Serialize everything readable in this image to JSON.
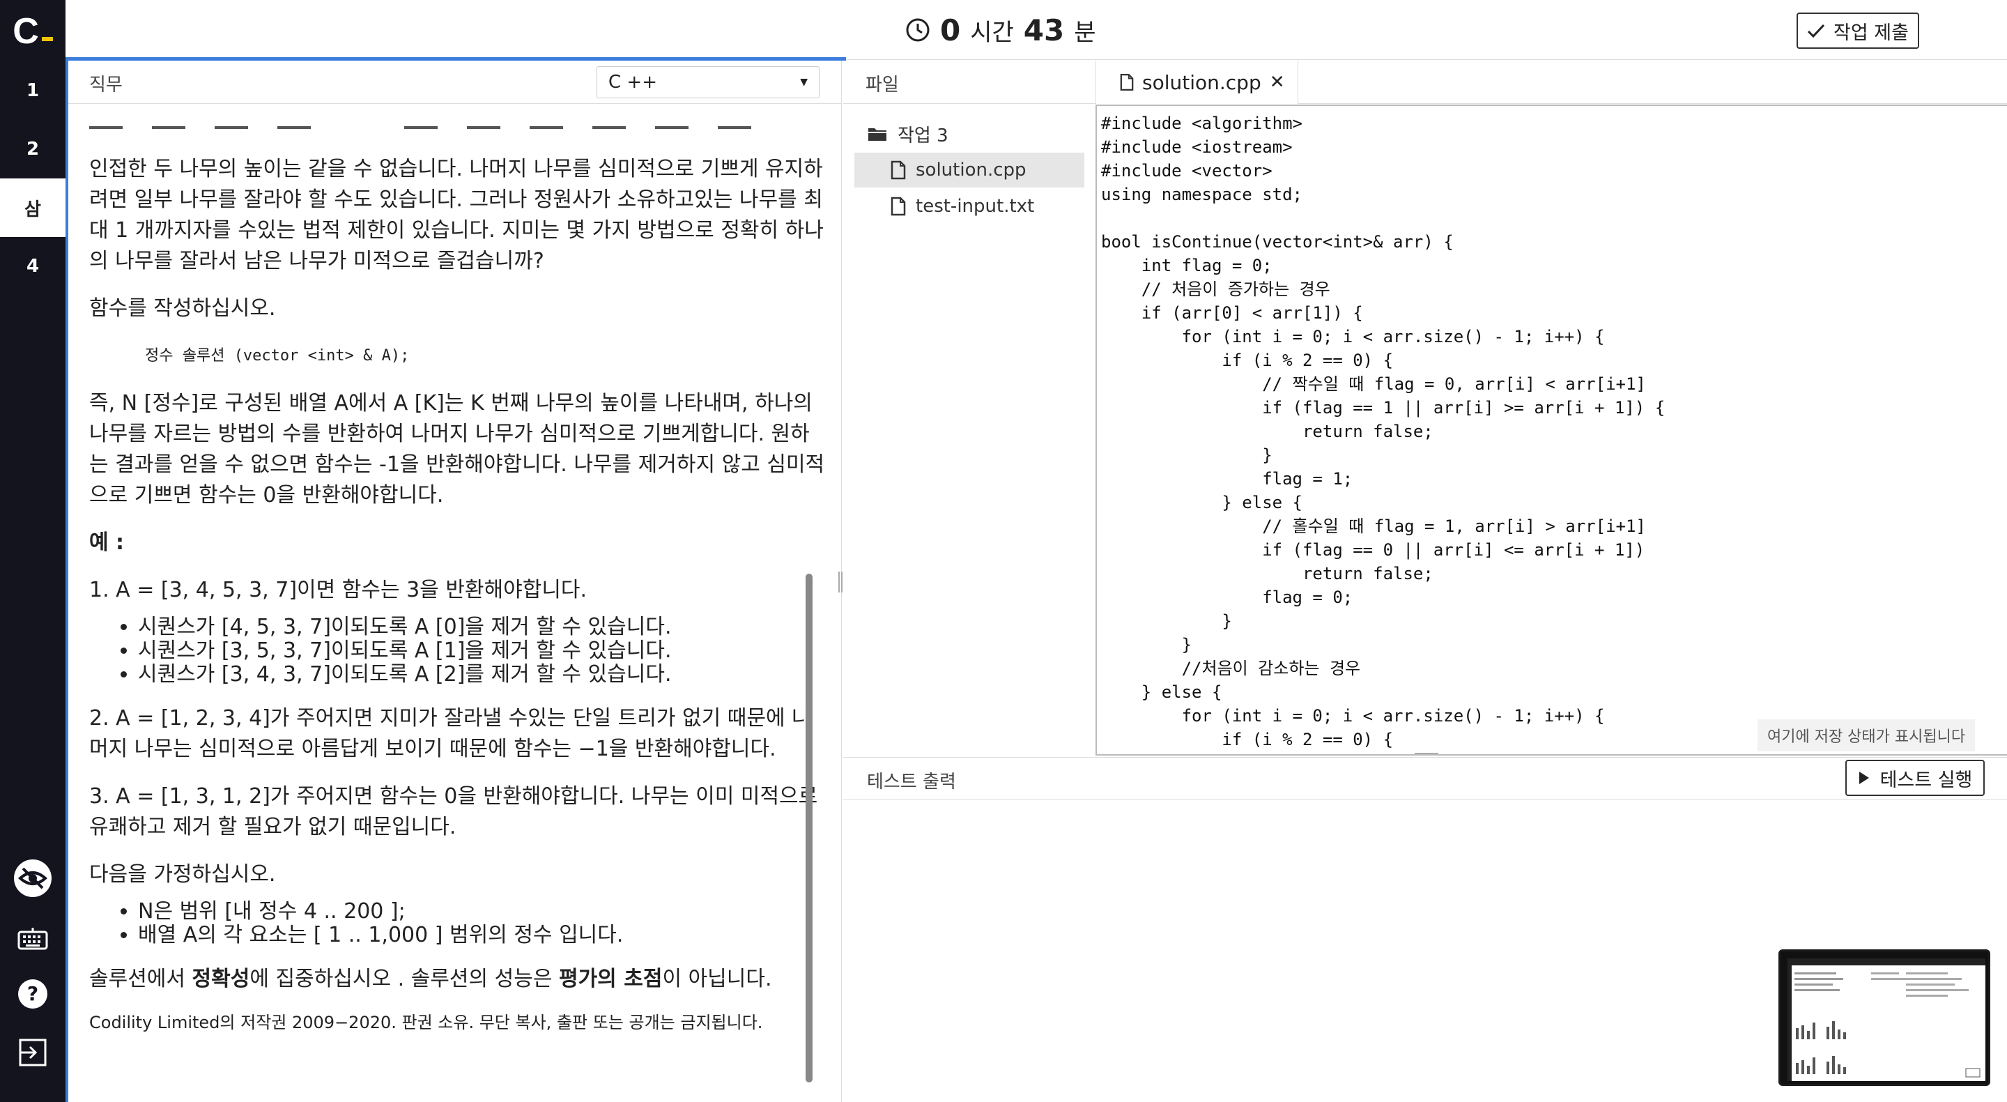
{
  "app": {
    "logo_letter": "C"
  },
  "timer": {
    "hours": "0",
    "hours_unit": "시간",
    "minutes": "43",
    "minutes_unit": "분"
  },
  "header": {
    "submit_label": "작업 제출"
  },
  "nav": {
    "tasks": [
      "1",
      "2",
      "삼",
      "4"
    ],
    "active_index": 2
  },
  "left_panel": {
    "title": "직무",
    "language": "C ++",
    "description": {
      "p1": "인접한 두 나무의 높이는 같을 수 없습니다. 나머지 나무를 심미적으로 기쁘게 유지하려면 일부 나무를 잘라야 할 수도 있습니다. 그러나 정원사가 소유하고있는 나무를 최대 1 개까지자를 수있는 법적 제한이 있습니다. 지미는 몇 가지 방법으로 정확히 하나의 나무를 잘라서 남은 나무가 미적으로 즐겁습니까?",
      "p2": "함수를 작성하십시오.",
      "signature": "정수 솔루션 (vector <int> & A);",
      "p3": "즉, N [정수]로 구성된 배열 A에서 A [K]는 K 번째 나무의 높이를 나타내며, 하나의 나무를 자르는 방법의 수를 반환하여 나머지 나무가 심미적으로 기쁘게합니다. 원하는 결과를 얻을 수 없으면 함수는 -1을 반환해야합니다. 나무를 제거하지 않고 심미적으로 기쁘면 함수는 0을 반환해야합니다.",
      "example_heading": "예 :",
      "ex1": "1. A = [3, 4, 5, 3, 7]이면 함수는 3을 반환해야합니다.",
      "ex1_items": [
        "시퀀스가 [4, 5, 3, 7]이되도록 A [0]을 제거 할 수 있습니다.",
        "시퀀스가 [3, 5, 3, 7]이되도록 A [1]을 제거 할 수 있습니다.",
        "시퀀스가 [3, 4, 3, 7]이되도록 A [2]를 제거 할 수 있습니다."
      ],
      "ex2": "2. A = [1, 2, 3, 4]가 주어지면 지미가 잘라낼 수있는 단일 트리가 없기 때문에 나머지 나무는 심미적으로 아름답게 보이기 때문에 함수는 −1을 반환해야합니다.",
      "ex3": "3. A = [1, 3, 1, 2]가 주어지면 함수는 0을 반환해야합니다. 나무는 이미 미적으로 유쾌하고 제거 할 필요가 없기 때문입니다.",
      "assume": "다음을 가정하십시오.",
      "assume_items": [
        "N은 범위 [내 정수 4 .. 200 ];",
        "배열 A의 각 요소는 [ 1 .. 1,000 ] 범위의 정수 입니다."
      ],
      "focus_pre": "솔루션에서 ",
      "focus_bold": "정확성",
      "focus_mid": "에 집중하십시오 . 솔루션의 성능은 ",
      "focus_bold2": "평가의 초점",
      "focus_post": "이 아닙니다.",
      "copyright": "Codility Limited의 저작권 2009−2020. 판권 소유. 무단 복사, 출판 또는 공개는 금지됩니다."
    }
  },
  "files": {
    "title": "파일",
    "folder": "작업 3",
    "items": [
      "solution.cpp",
      "test-input.txt"
    ],
    "selected_index": 0
  },
  "editor": {
    "tab": "solution.cpp",
    "code": "#include <algorithm>\n#include <iostream>\n#include <vector>\nusing namespace std;\n\nbool isContinue(vector<int>& arr) {\n    int flag = 0;\n    // 처음이 증가하는 경우\n    if (arr[0] < arr[1]) {\n        for (int i = 0; i < arr.size() - 1; i++) {\n            if (i % 2 == 0) {\n                // 짝수일 때 flag = 0, arr[i] < arr[i+1]\n                if (flag == 1 || arr[i] >= arr[i + 1]) {\n                    return false;\n                }\n                flag = 1;\n            } else {\n                // 홀수일 때 flag = 1, arr[i] > arr[i+1]\n                if (flag == 0 || arr[i] <= arr[i + 1])\n                    return false;\n                flag = 0;\n            }\n        }\n        //처음이 감소하는 경우\n    } else {\n        for (int i = 0; i < arr.size() - 1; i++) {\n            if (i % 2 == 0) {",
    "save_status": "여기에 저장 상태가 표시됩니다"
  },
  "test": {
    "title": "테스트 출력",
    "run_label": "테스트 실행"
  },
  "colors": {
    "rail": "#14141f",
    "accent_blue": "#3b7ddd",
    "logo_accent": "#f5c400"
  }
}
